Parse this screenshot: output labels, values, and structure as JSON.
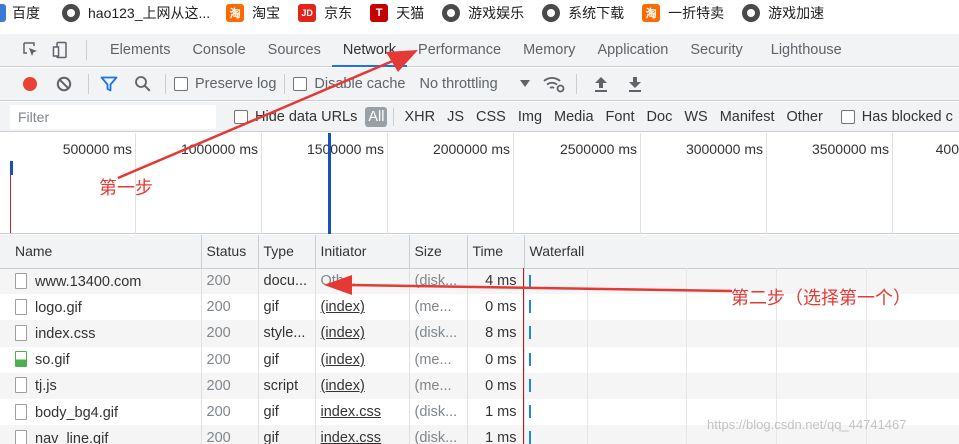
{
  "bookmarks": [
    {
      "label": "百度",
      "icon": "baidu-icon"
    },
    {
      "label": "hao123_上网从这...",
      "icon": "globe-icon"
    },
    {
      "label": "淘宝",
      "icon": "taobao-icon",
      "glyph": "淘"
    },
    {
      "label": "京东",
      "icon": "jd-icon",
      "glyph": "JD"
    },
    {
      "label": "天猫",
      "icon": "tmall-icon",
      "glyph": "T"
    },
    {
      "label": "游戏娱乐",
      "icon": "globe-icon"
    },
    {
      "label": "系统下载",
      "icon": "globe-icon"
    },
    {
      "label": "一折特卖",
      "icon": "taobao-icon",
      "glyph": "淘"
    },
    {
      "label": "游戏加速",
      "icon": "globe-icon"
    }
  ],
  "devtools": {
    "tabs": [
      "Elements",
      "Console",
      "Sources",
      "Network",
      "Performance",
      "Memory",
      "Application",
      "Security",
      "Lighthouse"
    ],
    "active_tab": "Network"
  },
  "toolbar": {
    "preserve_log": "Preserve log",
    "disable_cache": "Disable cache",
    "throttling": "No throttling"
  },
  "filter": {
    "placeholder": "Filter",
    "hide_data_urls": "Hide data URLs",
    "all": "All",
    "types": [
      "XHR",
      "JS",
      "CSS",
      "Img",
      "Media",
      "Font",
      "Doc",
      "WS",
      "Manifest",
      "Other"
    ],
    "has_blocked": "Has blocked c"
  },
  "overview": {
    "ticks": [
      "500000 ms",
      "1000000 ms",
      "1500000 ms",
      "2000000 ms",
      "2500000 ms",
      "3000000 ms",
      "3500000 ms",
      "400"
    ]
  },
  "table": {
    "columns": [
      "Name",
      "Status",
      "Type",
      "Initiator",
      "Size",
      "Time",
      "Waterfall"
    ],
    "rows": [
      {
        "name": "www.13400.com",
        "status": "200",
        "type": "docu...",
        "initiator": "Oth...",
        "size": "(disk...",
        "time": "4 ms",
        "icon": "document-icon"
      },
      {
        "name": "logo.gif",
        "status": "200",
        "type": "gif",
        "initiator": "(index)",
        "size": "(me...",
        "time": "0 ms",
        "icon": "file-icon"
      },
      {
        "name": "index.css",
        "status": "200",
        "type": "style...",
        "initiator": "(index)",
        "size": "(disk...",
        "time": "8 ms",
        "icon": "file-icon"
      },
      {
        "name": "so.gif",
        "status": "200",
        "type": "gif",
        "initiator": "(index)",
        "size": "(me...",
        "time": "0 ms",
        "icon": "image-icon"
      },
      {
        "name": "tj.js",
        "status": "200",
        "type": "script",
        "initiator": "(index)",
        "size": "(me...",
        "time": "0 ms",
        "icon": "script-icon"
      },
      {
        "name": "body_bg4.gif",
        "status": "200",
        "type": "gif",
        "initiator": "index.css",
        "size": "(disk...",
        "time": "1 ms",
        "icon": "file-icon"
      },
      {
        "name": "nav_line.gif",
        "status": "200",
        "type": "gif",
        "initiator": "index.css",
        "size": "(disk...",
        "time": "1 ms",
        "icon": "file-icon"
      }
    ]
  },
  "annotations": {
    "step1": "第一步",
    "step2": "第二步（选择第一个）",
    "color": "#e53935"
  },
  "watermark": "https://blog.csdn.net/qq_44741467"
}
